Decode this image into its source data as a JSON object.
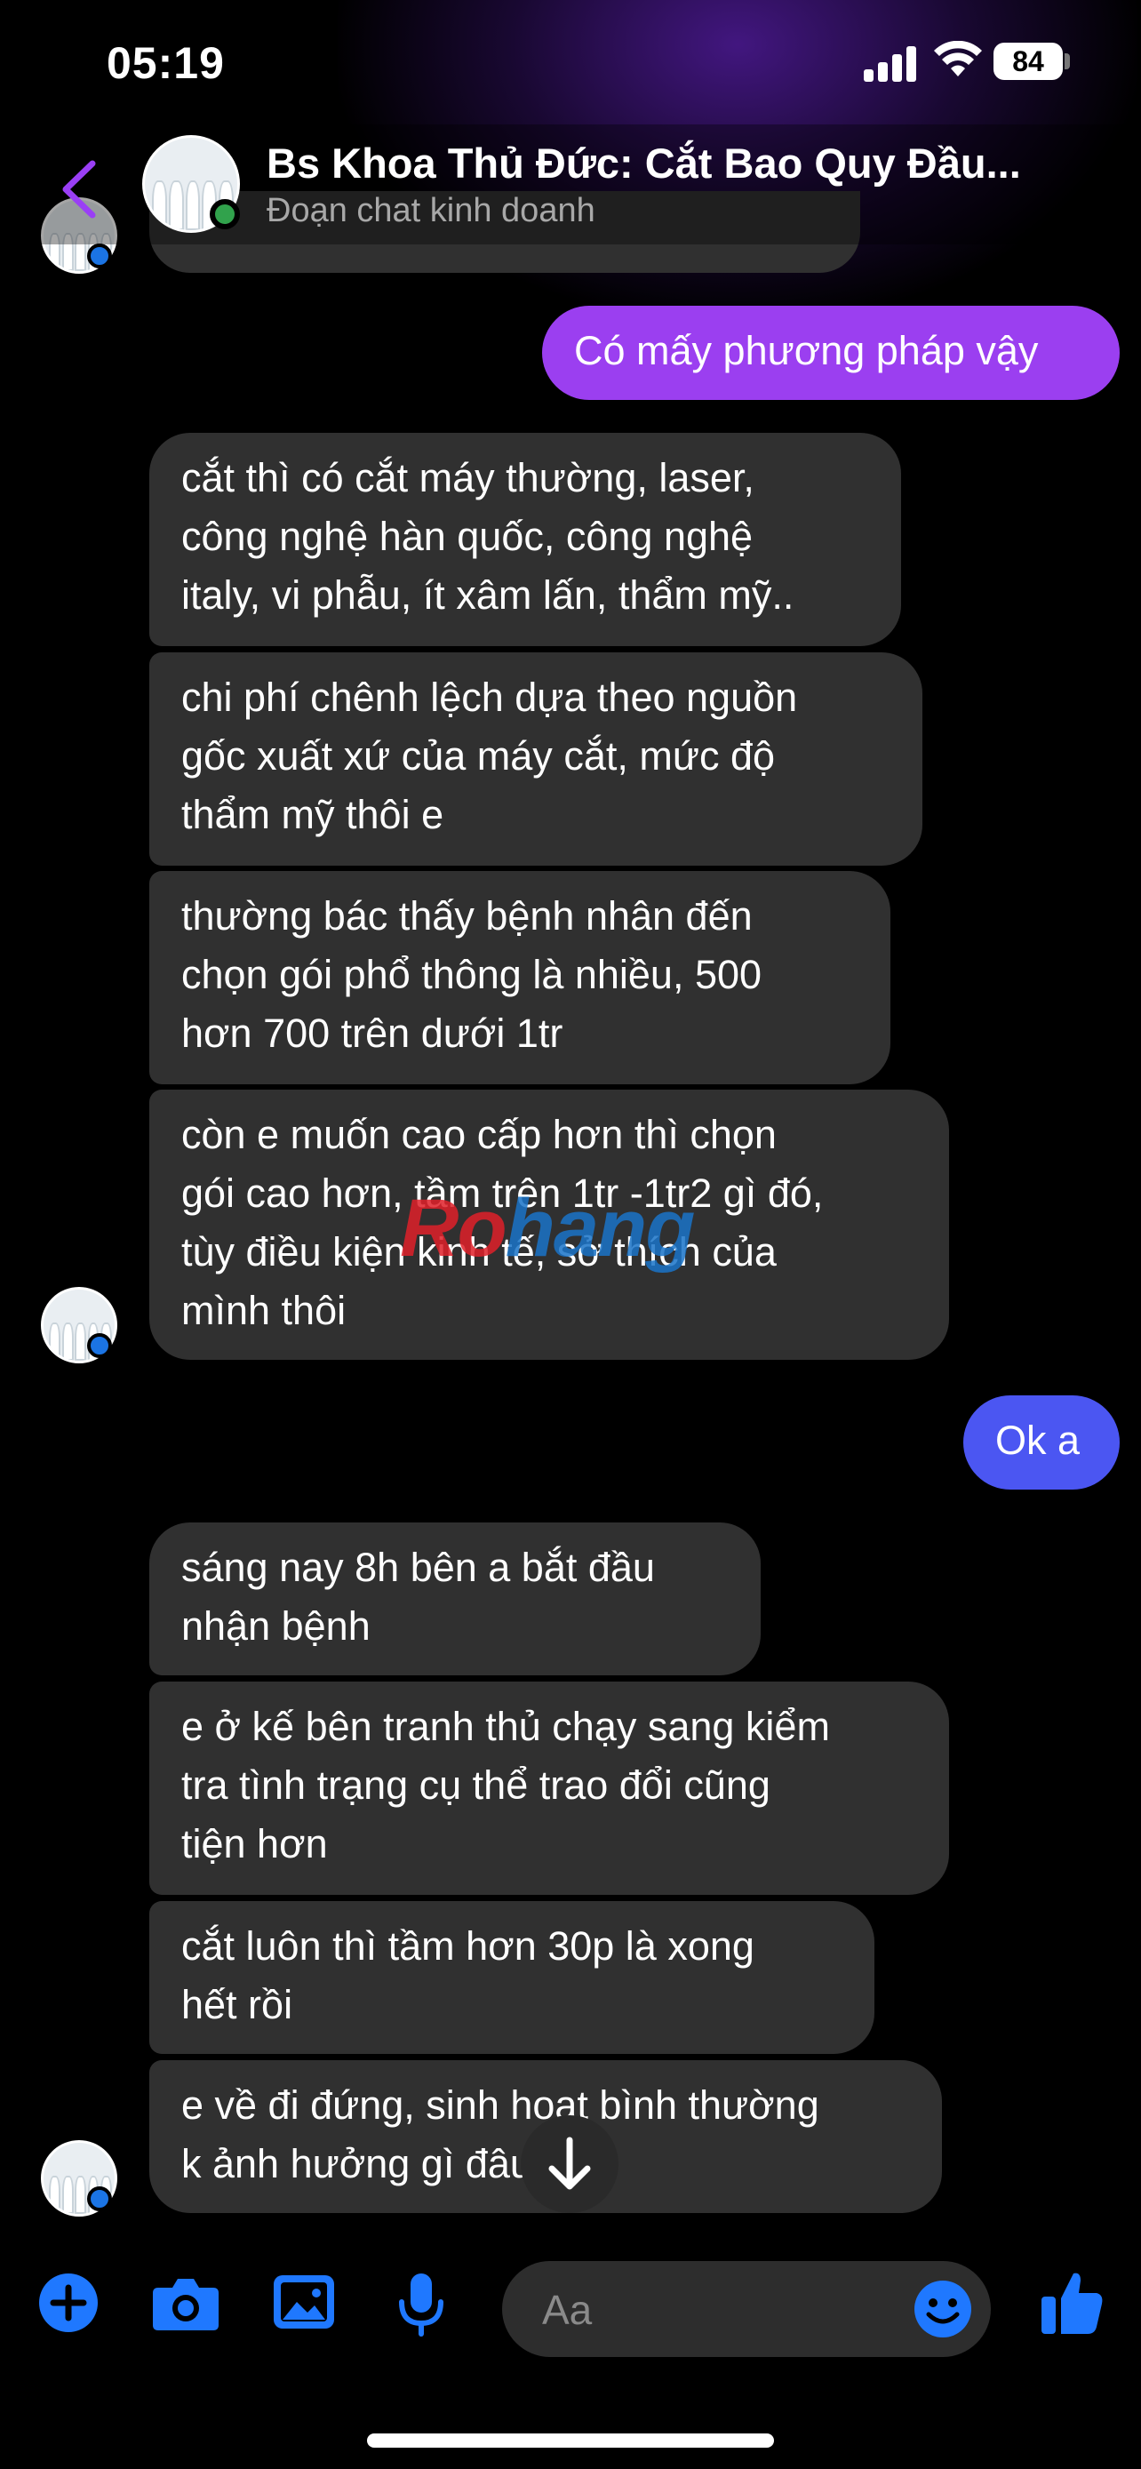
{
  "status_bar": {
    "time": "05:19",
    "battery": "84"
  },
  "header": {
    "title": "Bs Khoa Thủ Đức: Cắt Bao Quy Đầu...",
    "subtitle": "Đoạn chat kinh doanh"
  },
  "messages": [
    {
      "from": "me",
      "text": "Có mấy phương pháp vậy"
    },
    {
      "from": "them",
      "text": "cắt thì có cắt máy thường, laser,\ncông nghệ hàn quốc, công nghệ\nitaly, vi phẫu, ít xâm lấn, thẩm mỹ.."
    },
    {
      "from": "them",
      "text": "chi phí chênh lệch dựa theo nguồn\ngốc xuất xứ của máy cắt, mức độ\nthẩm mỹ thôi e"
    },
    {
      "from": "them",
      "text": "thường bác thấy bệnh nhân đến\nchọn gói phổ thông là nhiều, 500\nhơn 700 trên dưới 1tr"
    },
    {
      "from": "them",
      "text": "còn e muốn cao cấp hơn thì chọn\ngói cao hơn, tầm trên 1tr -1tr2 gì đó,\ntùy điều kiện kinh tế, sở thích của\nmình thôi"
    },
    {
      "from": "me",
      "text": "Ok a"
    },
    {
      "from": "them",
      "text": "sáng nay 8h bên a bắt đầu\nnhận bệnh"
    },
    {
      "from": "them",
      "text": "e ở kế bên tranh thủ chạy sang kiểm\ntra tình trạng cụ thể trao đổi cũng\ntiện hơn"
    },
    {
      "from": "them",
      "text": "cắt luôn thì tầm hơn 30p là xong\nhết rồi"
    },
    {
      "from": "them",
      "text": "e về đi đứng, sinh hoạt bình thường\nk ảnh hưởng gì đâu"
    }
  ],
  "watermark": {
    "part1": "Ro",
    "part2": "hang"
  },
  "composer": {
    "placeholder": "Aa"
  },
  "colors": {
    "accent": "#8a35f0",
    "outgoing_purple": "#9b3ff0",
    "outgoing_blue": "#4b56f2",
    "incoming": "#303030",
    "icon_blue": "#1f78ff"
  }
}
